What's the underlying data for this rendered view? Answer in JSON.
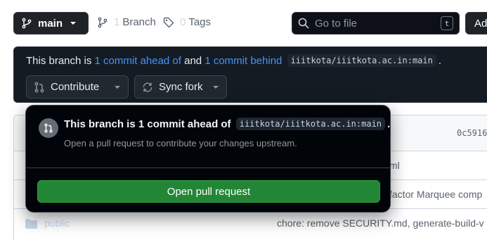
{
  "toolbar": {
    "branch_name": "main",
    "branches_count": "1",
    "branches_label": "Branch",
    "tags_count": "0",
    "tags_label": "Tags",
    "search_placeholder": "Go to file",
    "search_shortcut": "t",
    "add_label": "Add"
  },
  "banner": {
    "prefix": "This branch is",
    "ahead_link": "1 commit ahead of",
    "and_text": "and",
    "behind_link": "1 commit behind",
    "upstream": "iiitkota/iiitkota.ac.in:main",
    "period": ".",
    "contribute_label": "Contribute",
    "sync_label": "Sync fork"
  },
  "popover": {
    "title": "This branch is 1 commit ahead of",
    "upstream": "iiitkota/iiitkota.ac.in:main",
    "period": ".",
    "subtitle": "Open a pull request to contribute your changes upstream.",
    "button_label": "Open pull request"
  },
  "files": {
    "latest_sha": "0c5916",
    "rows": [
      {
        "name": "",
        "message": "ml"
      },
      {
        "name": "",
        "message": "factor Marquee comp"
      },
      {
        "name": "public",
        "message": "chore: remove SECURITY.md, generate-build-v"
      }
    ]
  },
  "colors": {
    "accent_link": "#4493f8",
    "primary_green": "#238636",
    "dark_bg": "#010409"
  }
}
